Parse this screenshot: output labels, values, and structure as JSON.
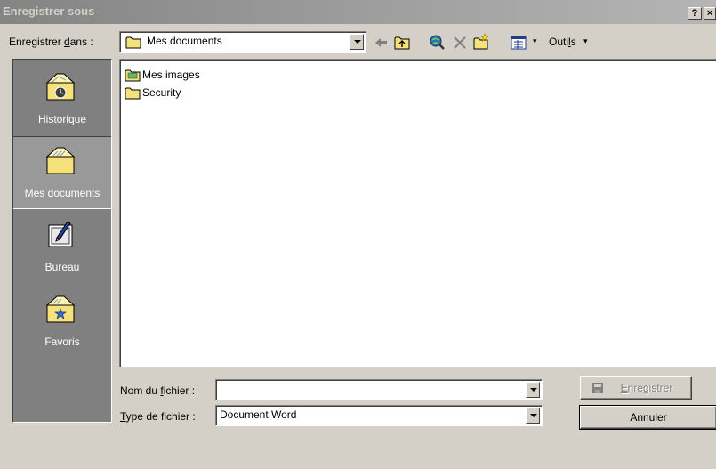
{
  "window": {
    "title": "Enregistrer sous",
    "help_label": "?",
    "close_label": "×"
  },
  "savein": {
    "label_pre": "Enregistrer ",
    "label_key": "d",
    "label_post": "ans :",
    "value": "Mes documents"
  },
  "toolbar": {
    "tools_pre": "Outi",
    "tools_key": "l",
    "tools_post": "s",
    "caret": "▾",
    "icons": [
      "back-arrow-icon",
      "up-folder-icon",
      "search-web-icon",
      "delete-icon",
      "new-folder-icon",
      "views-icon"
    ]
  },
  "places": [
    {
      "label": "Historique",
      "icon": "history-folder-icon"
    },
    {
      "label": "Mes documents",
      "icon": "my-documents-folder-icon"
    },
    {
      "label": "Bureau",
      "icon": "desktop-icon"
    },
    {
      "label": "Favoris",
      "icon": "favorites-folder-icon"
    }
  ],
  "files": [
    {
      "label": "Mes images",
      "icon": "pictures-folder-icon"
    },
    {
      "label": "Security",
      "icon": "folder-icon"
    }
  ],
  "filename": {
    "label_pre": "Nom du ",
    "label_key": "f",
    "label_post": "ichier :",
    "value": ""
  },
  "filetype": {
    "label_key": "T",
    "label_post": "ype de fichier :",
    "value": "Document Word"
  },
  "buttons": {
    "save_key": "E",
    "save_post": "nregistrer",
    "cancel": "Annuler"
  },
  "colors": {
    "titlebar_inactive": "#848484",
    "face": "#d4d0c8",
    "places_bg": "#808080",
    "folder_yellow": "#f6e27a"
  }
}
